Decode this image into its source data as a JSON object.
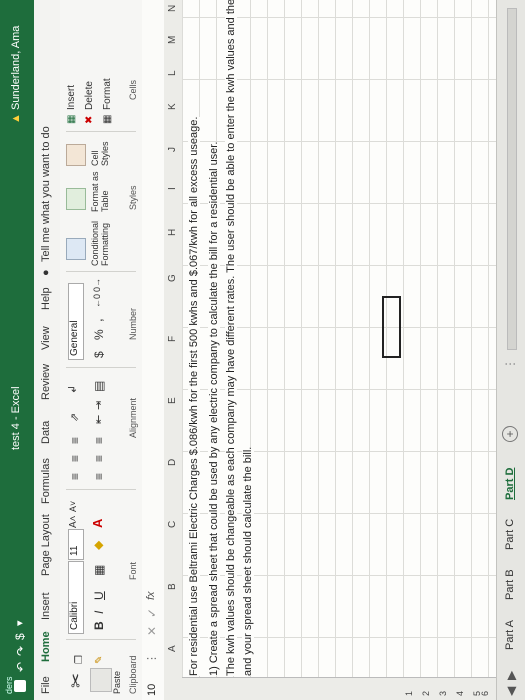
{
  "window": {
    "title": "test 4 - Excel",
    "user": "Sunderland, Ama",
    "tab_fragment": "ders"
  },
  "tabs": [
    "File",
    "Home",
    "Insert",
    "Page Layout",
    "Formulas",
    "Data",
    "Review",
    "View",
    "Help"
  ],
  "tell_me": "Tell me what you want to do",
  "ribbon": {
    "paste": "Paste",
    "clipboard": "Clipboard",
    "font_name": "Calibri",
    "font_size": "11",
    "font_grow": "A˄",
    "font_shrink": "A˅",
    "bold": "B",
    "italic": "I",
    "underline": "U",
    "font_color": "A",
    "font": "Font",
    "alignment": "Alignment",
    "number_format": "General",
    "currency": "$",
    "percent": "%",
    "comma": ",",
    "number": "Number",
    "conditional": [
      "Conditional",
      "Formatting"
    ],
    "format_as": [
      "Format as",
      "Table"
    ],
    "cell": [
      "Cell",
      "Styles"
    ],
    "styles": "Styles",
    "insert": "Insert",
    "delete": "Delete",
    "format": "Format",
    "cells": "Cells"
  },
  "formula_bar": {
    "name_box": "10",
    "fx": "fx",
    "content": ""
  },
  "columns": [
    "A",
    "B",
    "C",
    "D",
    "E",
    "F",
    "G",
    "H",
    "I",
    "J",
    "K",
    "L",
    "M",
    "N"
  ],
  "rows": [
    "",
    "1",
    "2",
    "3",
    "4",
    "5",
    "6",
    "7"
  ],
  "cells": {
    "line1": "For residential use Beltrami Electric Charges $.086/kwh for the first 500 kwhs and $.067/kwh for all excess useage.",
    "line2": "1) Create a spread sheet that could be used by any electric company to calculate the bill for a residential user.",
    "line3": "The kwh values should be changeable as each company may have different rates. The user should be able to enter the kwh values and the usage",
    "line4": "and your spread sheet should calculate the bill."
  },
  "sheets": [
    "Part A",
    "Part B",
    "Part C",
    "Part D"
  ],
  "active_sheet": "Part D",
  "colors": {
    "accent": "#1e6d3c",
    "ribbon_bg": "#f6f6f4"
  }
}
